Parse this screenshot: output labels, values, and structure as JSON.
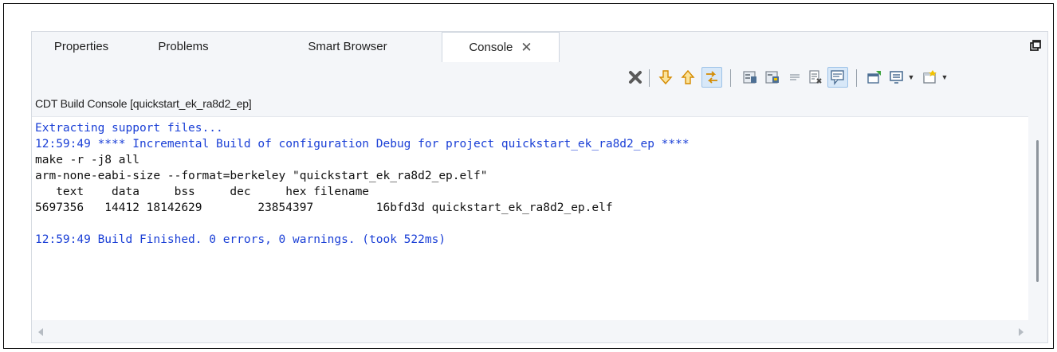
{
  "tabs": [
    {
      "label": "Properties",
      "active": false
    },
    {
      "label": "Problems",
      "active": false
    },
    {
      "label": "Smart Browser",
      "active": false
    },
    {
      "label": "Console",
      "active": true
    }
  ],
  "console": {
    "title": "CDT Build Console [quickstart_ek_ra8d2_ep]",
    "lines": [
      {
        "text": "Extracting support files...",
        "color": "#1a3fd6"
      },
      {
        "text": "12:59:49 **** Incremental Build of configuration Debug for project quickstart_ek_ra8d2_ep ****",
        "color": "#1a3fd6"
      },
      {
        "text": "make -r -j8 all",
        "color": "#111111"
      },
      {
        "text": "arm-none-eabi-size --format=berkeley \"quickstart_ek_ra8d2_ep.elf\"",
        "color": "#111111"
      },
      {
        "text": "   text    data     bss     dec     hex filename",
        "color": "#111111"
      },
      {
        "text": "5697356   14412 18142629        23854397         16bfd3d quickstart_ek_ra8d2_ep.elf",
        "color": "#111111"
      },
      {
        "text": "",
        "color": "#111111"
      },
      {
        "text": "12:59:49 Build Finished. 0 errors, 0 warnings. (took 522ms)",
        "color": "#1a3fd6"
      }
    ]
  },
  "toolbar_icons": [
    "clear-console-icon",
    "scroll-down-icon",
    "scroll-up-icon",
    "scroll-lock-icon",
    "pin-console-icon",
    "word-wrap-icon",
    "show-console-on-output-icon",
    "show-console-on-error-icon",
    "display-selected-console-icon",
    "new-console-icon",
    "open-console-icon"
  ],
  "colors": {
    "console_blue": "#1a3fd6",
    "console_black": "#111111",
    "clear_red": "#555555",
    "arrow_orange": "#e8a317"
  }
}
